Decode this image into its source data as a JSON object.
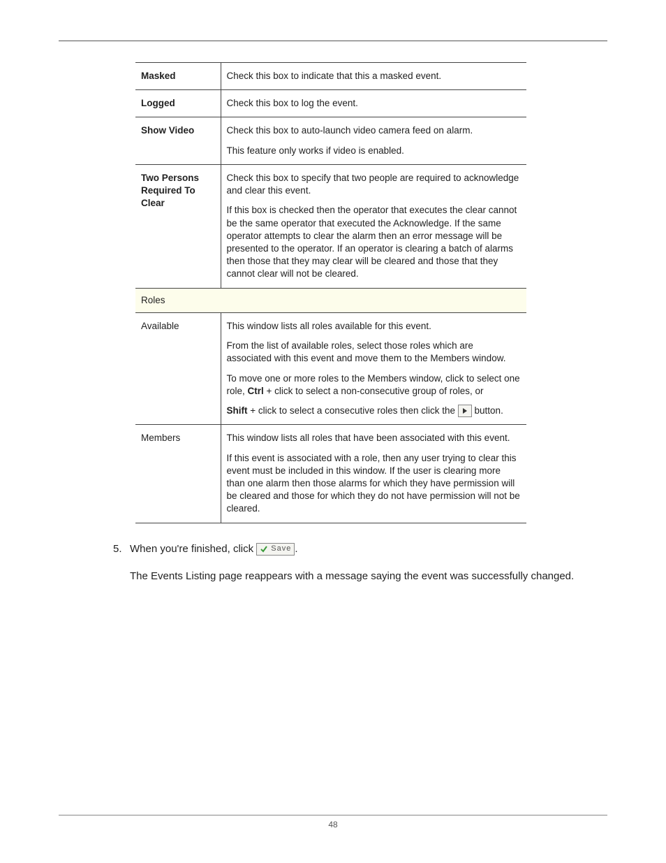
{
  "page_number": "48",
  "rows": {
    "masked": {
      "label": "Masked",
      "desc": "Check this box to indicate that this a masked event."
    },
    "logged": {
      "label": "Logged",
      "desc": "Check this box to log the event."
    },
    "show_video": {
      "label": "Show Video",
      "p1": "Check this box to auto-launch video camera feed on alarm.",
      "p2": "This feature only works if video is enabled."
    },
    "two_persons": {
      "label": "Two Persons Required To Clear",
      "p1": "Check this box to specify that two people are required to acknowledge and clear this event.",
      "p2": "If this box is checked then the operator that executes the clear cannot be the same operator that executed the Acknowledge. If the same operator attempts to clear the alarm then an error message will be presented to the operator. If an operator is clearing a batch of alarms then those that they may clear will be cleared and those that they cannot clear will not be cleared."
    },
    "roles_section": "Roles",
    "available": {
      "label": "Available",
      "p1": "This window lists all roles available for this event.",
      "p2": "From the list of available roles, select those roles which are associated with this event and move them to the Members window.",
      "p3_a": "To move one or more roles to the Members window, click to select one role, ",
      "p3_ctrl": "Ctrl",
      "p3_b": " + click to select a non-consecutive group of roles, or",
      "p4_shift": "Shift",
      "p4_a": " + click to select a consecutive roles then click the ",
      "p4_b": " button."
    },
    "members": {
      "label": "Members",
      "p1": "This window lists all roles that have been associated with this event.",
      "p2": "If this event is associated with a role, then any user trying to clear this event must be included in this window. If the user is clearing more than one alarm then those alarms for which they have permission will be cleared and those for which they do not have permission will not be cleared."
    }
  },
  "step": {
    "num": "5.",
    "prefix": "When you're finished, click ",
    "save_label": "Save",
    "suffix": "."
  },
  "result": "The Events Listing page reappears with a message saying the event was successfully changed."
}
